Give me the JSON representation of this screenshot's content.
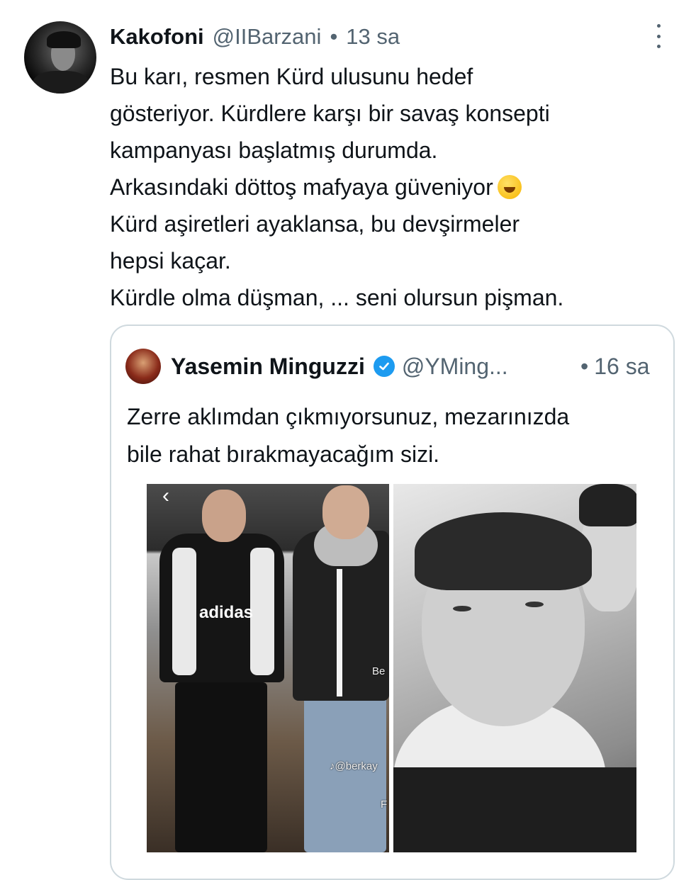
{
  "tweet": {
    "author_name": "Kakofoni",
    "author_handle": "@IIBarzani",
    "dot": "•",
    "time": "13 sa",
    "lines": [
      "Bu karı, resmen Kürd ulusunu hedef",
      "gösteriyor. Kürdlere karşı bir savaş konsepti",
      "kampanyası başlatmış durumda.",
      "Arkasındaki döttoş mafyaya güveniyor",
      "Kürd aşiretleri ayaklansa, bu devşirmeler",
      "hepsi kaçar.",
      "Kürdle olma düşman, ... seni olursun pişman."
    ],
    "emoji_icon": "rolling-on-floor-laughing-emoji"
  },
  "quote": {
    "author_name": "Yasemin Minguzzi",
    "verified_icon": "verified-badge-icon",
    "author_handle": "@YMing...",
    "dot": "•",
    "time": "16 sa",
    "lines": [
      "Zerre aklımdan çıkmıyorsunuz, mezarınızda",
      "bile rahat bırakmayacağım sizi."
    ],
    "media": {
      "watermark_left": "♪@berkay",
      "watermark_right_top": "Be",
      "watermark_right_bottom": "F",
      "shirt_text": "adidas"
    }
  },
  "colors": {
    "text": "#0f1419",
    "secondary": "#536471",
    "border": "#cfd9de",
    "verified": "#1d9bf0"
  }
}
